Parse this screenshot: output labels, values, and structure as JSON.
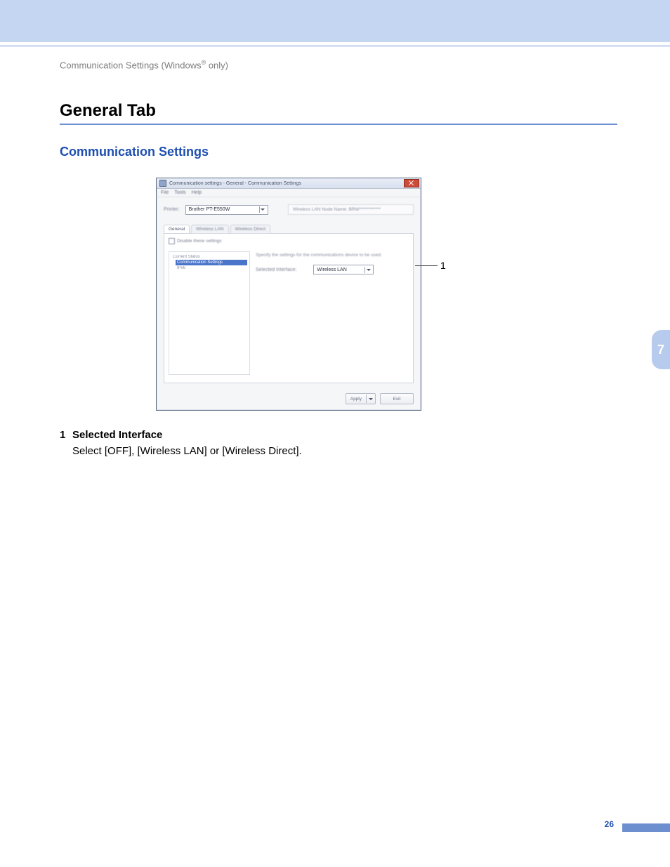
{
  "breadcrumb": {
    "prefix": "Communication Settings (Windows",
    "reg": "®",
    "suffix": " only)"
  },
  "section_title": "General Tab",
  "subsection_title": "Communication Settings",
  "dialog": {
    "title": "Communication settings - General - Communication Settings",
    "menubar": [
      "File",
      "Tools",
      "Help"
    ],
    "printer_label": "Printer:",
    "printer_value": "Brother PT-E550W",
    "node_name_label": "Wireless LAN Node Name: BRW************",
    "tabs": [
      "General",
      "Wireless LAN",
      "Wireless Direct"
    ],
    "disable_checkbox_label": "Disable these settings",
    "tree": {
      "root": "Current Status",
      "selected": "Communication Settings",
      "child": "IPv6"
    },
    "description": "Specify the settings for the communications device to be used.",
    "field_label": "Selected Interface:",
    "field_value": "Wireless LAN",
    "buttons": {
      "apply": "Apply",
      "exit": "Exit"
    }
  },
  "callout_number": "1",
  "definition": {
    "num": "1",
    "term": "Selected Interface",
    "desc": "Select [OFF], [Wireless LAN] or [Wireless Direct]."
  },
  "chapter_number": "7",
  "page_number": "26"
}
